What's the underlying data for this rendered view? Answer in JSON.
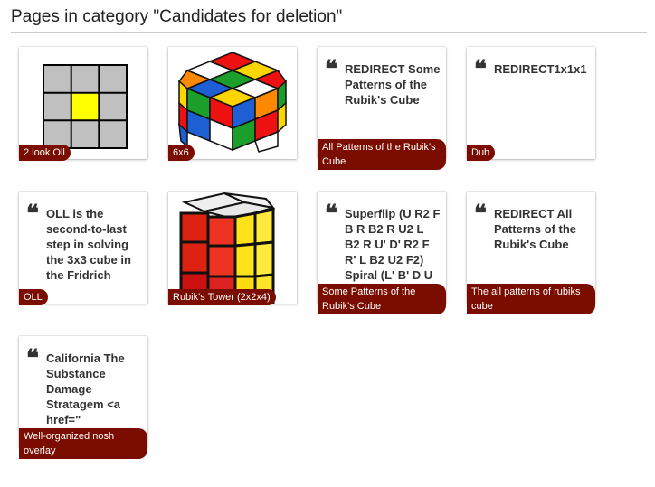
{
  "page": {
    "title": "Pages in category \"Candidates for deletion\""
  },
  "cards": [
    {
      "type": "image",
      "image": "oll-grid-icon",
      "label": "2 look Oll"
    },
    {
      "type": "image",
      "image": "rubiks-cube-3x3-photo-icon",
      "label": "6x6"
    },
    {
      "type": "quote",
      "quote": "REDIRECT Some Patterns of the Rubik's Cube",
      "label": "All Patterns of the Rubik's Cube"
    },
    {
      "type": "quote",
      "quote": "REDIRECT1x1x1",
      "label": "Duh"
    },
    {
      "type": "quote",
      "quote": "OLL is the second-to-last step in solving the 3x3 cube in the Fridrich",
      "label": "OLL"
    },
    {
      "type": "image",
      "image": "rubiks-tower-2x2x4-photo-icon",
      "label": "Rubik's Tower (2x2x4)"
    },
    {
      "type": "quote",
      "quote": "Superflip (U R2 F B R B2 R U2 L B2 R U' D' R2 F R' L B2 U2 F2) Spiral (L' B' D U",
      "label": "Some Patterns of the Rubik's Cube"
    },
    {
      "type": "quote",
      "quote": "REDIRECT All Patterns of the Rubik's Cube",
      "label": "The all patterns of rubiks cube"
    },
    {
      "type": "quote",
      "quote": "California The Substance Damage Stratagem <a href=\"",
      "label": "Well-organized nosh overlay"
    }
  ],
  "colors": {
    "label_bg": "#7a0d00",
    "oll_yellow": "#ffff00",
    "oll_gray": "#c0c0c0"
  }
}
